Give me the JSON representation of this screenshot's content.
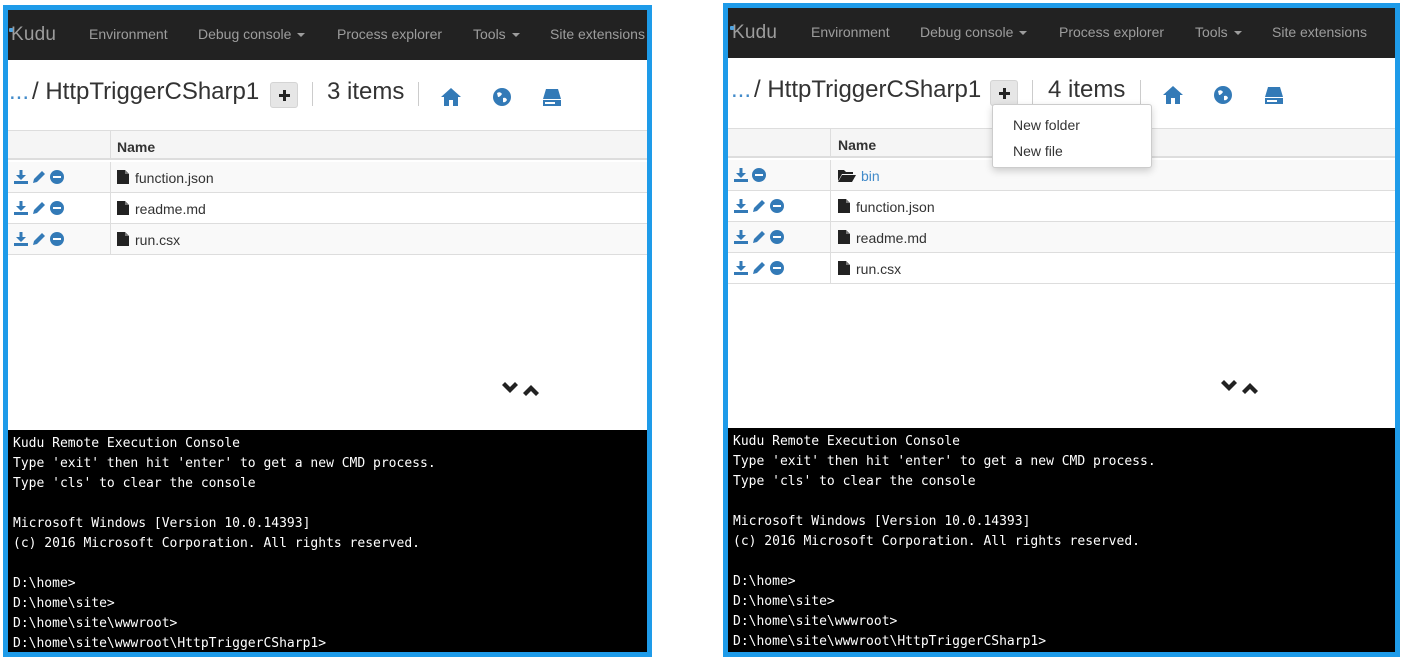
{
  "colors": {
    "frame_border": "#1e9be9",
    "navbar_bg": "#222222",
    "navbar_text": "#9d9d9d",
    "icon_blue": "#337ab7",
    "link_blue": "#428bca",
    "console_bg": "#000000",
    "console_text": "#ffffff"
  },
  "left": {
    "navbar": {
      "brand": "Kudu",
      "items": [
        "Environment",
        "Debug console",
        "Process explorer",
        "Tools",
        "Site extensions"
      ]
    },
    "breadcrumb": {
      "ellipsis": "...",
      "path": " / HttpTriggerCSharp1",
      "item_count": "3 items"
    },
    "toolbar_icons": [
      "home-icon",
      "globe-icon",
      "drive-icon"
    ],
    "table": {
      "column_name": "Name",
      "rows": [
        {
          "name": "function.json",
          "icon": "file-icon",
          "actions": [
            "download-icon",
            "edit-icon",
            "delete-icon"
          ]
        },
        {
          "name": "readme.md",
          "icon": "file-icon",
          "actions": [
            "download-icon",
            "edit-icon",
            "delete-icon"
          ]
        },
        {
          "name": "run.csx",
          "icon": "file-icon",
          "actions": [
            "download-icon",
            "edit-icon",
            "delete-icon"
          ]
        }
      ]
    },
    "console": {
      "lines": [
        "Kudu Remote Execution Console",
        "Type 'exit' then hit 'enter' to get a new CMD process.",
        "Type 'cls' to clear the console",
        "",
        "Microsoft Windows [Version 10.0.14393]",
        "(c) 2016 Microsoft Corporation. All rights reserved.",
        "",
        "D:\\home>",
        "D:\\home\\site>",
        "D:\\home\\site\\wwwroot>",
        "D:\\home\\site\\wwwroot\\HttpTriggerCSharp1>"
      ]
    }
  },
  "right": {
    "navbar": {
      "brand": "Kudu",
      "items": [
        "Environment",
        "Debug console",
        "Process explorer",
        "Tools",
        "Site extensions"
      ]
    },
    "breadcrumb": {
      "ellipsis": "...",
      "path": " / HttpTriggerCSharp1",
      "item_count": "4 items"
    },
    "dropdown": {
      "items": [
        "New folder",
        "New file"
      ]
    },
    "table": {
      "column_name": "Name",
      "rows": [
        {
          "name": "bin",
          "icon": "folder-open-icon",
          "actions": [
            "download-icon",
            "delete-icon"
          ]
        },
        {
          "name": "function.json",
          "icon": "file-icon",
          "actions": [
            "download-icon",
            "edit-icon",
            "delete-icon"
          ]
        },
        {
          "name": "readme.md",
          "icon": "file-icon",
          "actions": [
            "download-icon",
            "edit-icon",
            "delete-icon"
          ]
        },
        {
          "name": "run.csx",
          "icon": "file-icon",
          "actions": [
            "download-icon",
            "edit-icon",
            "delete-icon"
          ]
        }
      ]
    },
    "console": {
      "lines": [
        "Kudu Remote Execution Console",
        "Type 'exit' then hit 'enter' to get a new CMD process.",
        "Type 'cls' to clear the console",
        "",
        "Microsoft Windows [Version 10.0.14393]",
        "(c) 2016 Microsoft Corporation. All rights reserved.",
        "",
        "D:\\home>",
        "D:\\home\\site>",
        "D:\\home\\site\\wwwroot>",
        "D:\\home\\site\\wwwroot\\HttpTriggerCSharp1>"
      ]
    }
  }
}
